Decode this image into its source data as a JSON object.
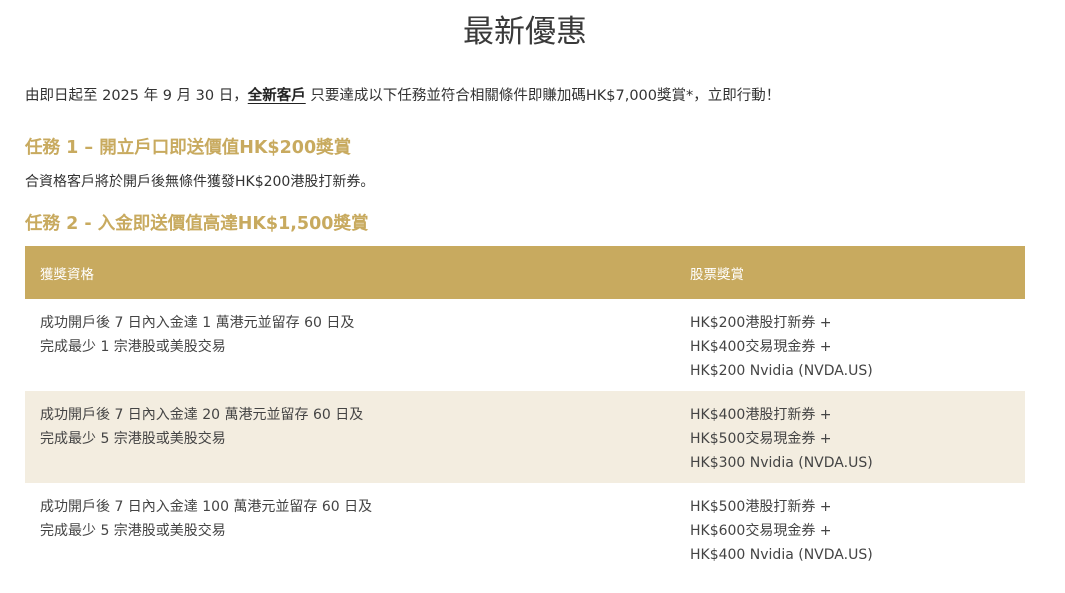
{
  "page": {
    "title": "最新優惠"
  },
  "intro": {
    "before": "由即日起至 2025 年 9 月 30 日，",
    "link": "全新客戶",
    "after": " 只要達成以下任務並符合相關條件即賺加碼HK$7,000獎賞*，立即行動！"
  },
  "task1": {
    "heading": "任務 1 – 開立戶口即送價值HK$200獎賞",
    "description": "合資格客戶將於開戶後無條件獲發HK$200港股打新券。"
  },
  "task2": {
    "heading": "任務 2 - 入金即送價值高達HK$1,500獎賞",
    "table": {
      "headers": [
        "獲獎資格",
        "股票獎賞"
      ],
      "rows": [
        {
          "qualification": [
            "成功開戶後 7 日內入金達 1 萬港元並留存 60 日及",
            "完成最少 1 宗港股或美股交易"
          ],
          "reward": [
            "HK$200港股打新券 +",
            "HK$400交易現金券 +",
            "HK$200 Nvidia (NVDA.US)"
          ]
        },
        {
          "qualification": [
            "成功開戶後 7 日內入金達 20 萬港元並留存 60 日及",
            "完成最少 5 宗港股或美股交易"
          ],
          "reward": [
            "HK$400港股打新券 +",
            "HK$500交易現金券 +",
            "HK$300 Nvidia (NVDA.US)"
          ]
        },
        {
          "qualification": [
            "成功開戶後 7 日內入金達 100 萬港元並留存 60 日及",
            "完成最少 5 宗港股或美股交易"
          ],
          "reward": [
            "HK$500港股打新券 +",
            "HK$600交易現金券 +",
            "HK$400 Nvidia (NVDA.US)"
          ]
        }
      ]
    }
  },
  "colors": {
    "accent_gold": "#c8aa5f",
    "row_alt_bg": "#f3ede0",
    "text": "#333333"
  }
}
